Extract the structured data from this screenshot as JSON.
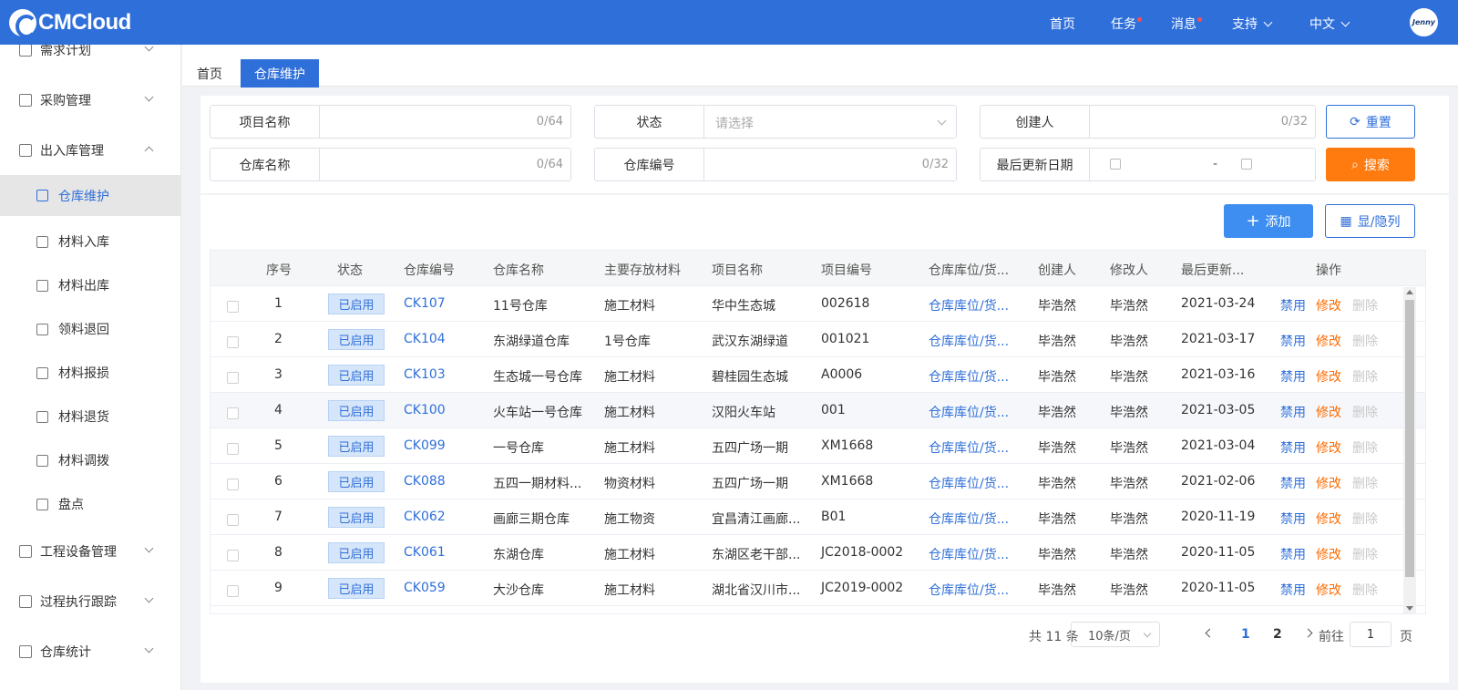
{
  "header": {
    "logo_text": "CMCloud",
    "nav": [
      {
        "label": "首页",
        "dot": false
      },
      {
        "label": "任务",
        "dot": true
      },
      {
        "label": "消息",
        "dot": true
      },
      {
        "label": "支持",
        "dropdown": true
      },
      {
        "label": "中文",
        "dropdown": true
      }
    ],
    "avatar_text": "Jenny"
  },
  "sidebar": {
    "items": [
      {
        "label": "需求计划",
        "icon": "plan-icon",
        "expanded": false
      },
      {
        "label": "采购管理",
        "icon": "purchase-icon",
        "expanded": false
      },
      {
        "label": "出入库管理",
        "icon": "warehouse-icon",
        "expanded": true
      },
      {
        "label": "仓库维护",
        "icon": "warehouse-icon",
        "active": true
      },
      {
        "label": "材料入库",
        "icon": "material-in-icon"
      },
      {
        "label": "材料出库",
        "icon": "material-out-icon"
      },
      {
        "label": "领料退回",
        "icon": "return-icon"
      },
      {
        "label": "材料报损",
        "icon": "report-icon"
      },
      {
        "label": "材料退货",
        "icon": "refund-icon"
      },
      {
        "label": "材料调拨",
        "icon": "transfer-icon"
      },
      {
        "label": "盘点",
        "icon": "inventory-icon"
      },
      {
        "label": "工程设备管理",
        "icon": "cube-icon",
        "expanded": false
      },
      {
        "label": "过程执行跟踪",
        "icon": "track-icon",
        "expanded": false
      },
      {
        "label": "仓库统计",
        "icon": "stats-icon",
        "expanded": false
      }
    ]
  },
  "tabs": [
    {
      "label": "首页"
    },
    {
      "label": "仓库维护",
      "active": true
    }
  ],
  "filters": {
    "project_name": {
      "label": "项目名称",
      "count": "0/64"
    },
    "status": {
      "label": "状态",
      "placeholder": "请选择"
    },
    "creator": {
      "label": "创建人",
      "count": "0/32"
    },
    "warehouse_name": {
      "label": "仓库名称",
      "count": "0/64"
    },
    "warehouse_code": {
      "label": "仓库编号",
      "count": "0/32"
    },
    "last_updated": {
      "label": "最后更新日期",
      "separator": "-"
    }
  },
  "buttons": {
    "reset": "重置",
    "search": "搜索",
    "add": "添加",
    "columns": "显/隐列"
  },
  "table": {
    "headers": [
      "序号",
      "状态",
      "仓库编号",
      "仓库名称",
      "主要存放材料",
      "项目名称",
      "项目编号",
      "仓库库位/货...",
      "创建人",
      "修改人",
      "最后更新...",
      "操作"
    ],
    "rows": [
      {
        "no": "1",
        "status": "已启用",
        "code": "CK107",
        "name": "11号仓库",
        "material": "施工材料",
        "project": "华中生态城",
        "project_no": "002618",
        "location": "仓库库位/货...",
        "creator": "毕浩然",
        "modifier": "毕浩然",
        "updated": "2021-03-24"
      },
      {
        "no": "2",
        "status": "已启用",
        "code": "CK104",
        "name": "东湖绿道仓库",
        "material": "1号仓库",
        "project": "武汉东湖绿道",
        "project_no": "001021",
        "location": "仓库库位/货...",
        "creator": "毕浩然",
        "modifier": "毕浩然",
        "updated": "2021-03-17"
      },
      {
        "no": "3",
        "status": "已启用",
        "code": "CK103",
        "name": "生态城一号仓库",
        "material": "施工材料",
        "project": "碧桂园生态城",
        "project_no": "A0006",
        "location": "仓库库位/货...",
        "creator": "毕浩然",
        "modifier": "毕浩然",
        "updated": "2021-03-16"
      },
      {
        "no": "4",
        "status": "已启用",
        "code": "CK100",
        "name": "火车站一号仓库",
        "material": "施工材料",
        "project": "汉阳火车站",
        "project_no": "001",
        "location": "仓库库位/货...",
        "creator": "毕浩然",
        "modifier": "毕浩然",
        "updated": "2021-03-05"
      },
      {
        "no": "5",
        "status": "已启用",
        "code": "CK099",
        "name": "一号仓库",
        "material": "施工材料",
        "project": "五四广场一期",
        "project_no": "XM1668",
        "location": "仓库库位/货...",
        "creator": "毕浩然",
        "modifier": "毕浩然",
        "updated": "2021-03-04"
      },
      {
        "no": "6",
        "status": "已启用",
        "code": "CK088",
        "name": "五四一期材料...",
        "material": "物资材料",
        "project": "五四广场一期",
        "project_no": "XM1668",
        "location": "仓库库位/货...",
        "creator": "毕浩然",
        "modifier": "毕浩然",
        "updated": "2021-02-06"
      },
      {
        "no": "7",
        "status": "已启用",
        "code": "CK062",
        "name": "画廊三期仓库",
        "material": "施工物资",
        "project": "宜昌清江画廊...",
        "project_no": "B01",
        "location": "仓库库位/货...",
        "creator": "毕浩然",
        "modifier": "毕浩然",
        "updated": "2020-11-19"
      },
      {
        "no": "8",
        "status": "已启用",
        "code": "CK061",
        "name": "东湖仓库",
        "material": "施工材料",
        "project": "东湖区老干部...",
        "project_no": "JC2018-0002",
        "location": "仓库库位/货...",
        "creator": "毕浩然",
        "modifier": "毕浩然",
        "updated": "2020-11-05"
      },
      {
        "no": "9",
        "status": "已启用",
        "code": "CK059",
        "name": "大沙仓库",
        "material": "施工材料",
        "project": "湖北省汉川市...",
        "project_no": "JC2019-0002",
        "location": "仓库库位/货...",
        "creator": "毕浩然",
        "modifier": "毕浩然",
        "updated": "2020-11-05"
      }
    ],
    "row_actions": {
      "disable": "禁用",
      "edit": "修改",
      "delete": "删除"
    }
  },
  "pagination": {
    "total": "共 11 条",
    "page_size": "10条/页",
    "pages": [
      "1",
      "2"
    ],
    "current": "1",
    "goto_prefix": "前往",
    "goto_value": "1",
    "goto_suffix": "页"
  },
  "colors": {
    "primary": "#2f6fd9",
    "accent_orange": "#ff7b0f",
    "edit_orange": "#ff6a00",
    "dot_red": "#ff4d4f"
  }
}
